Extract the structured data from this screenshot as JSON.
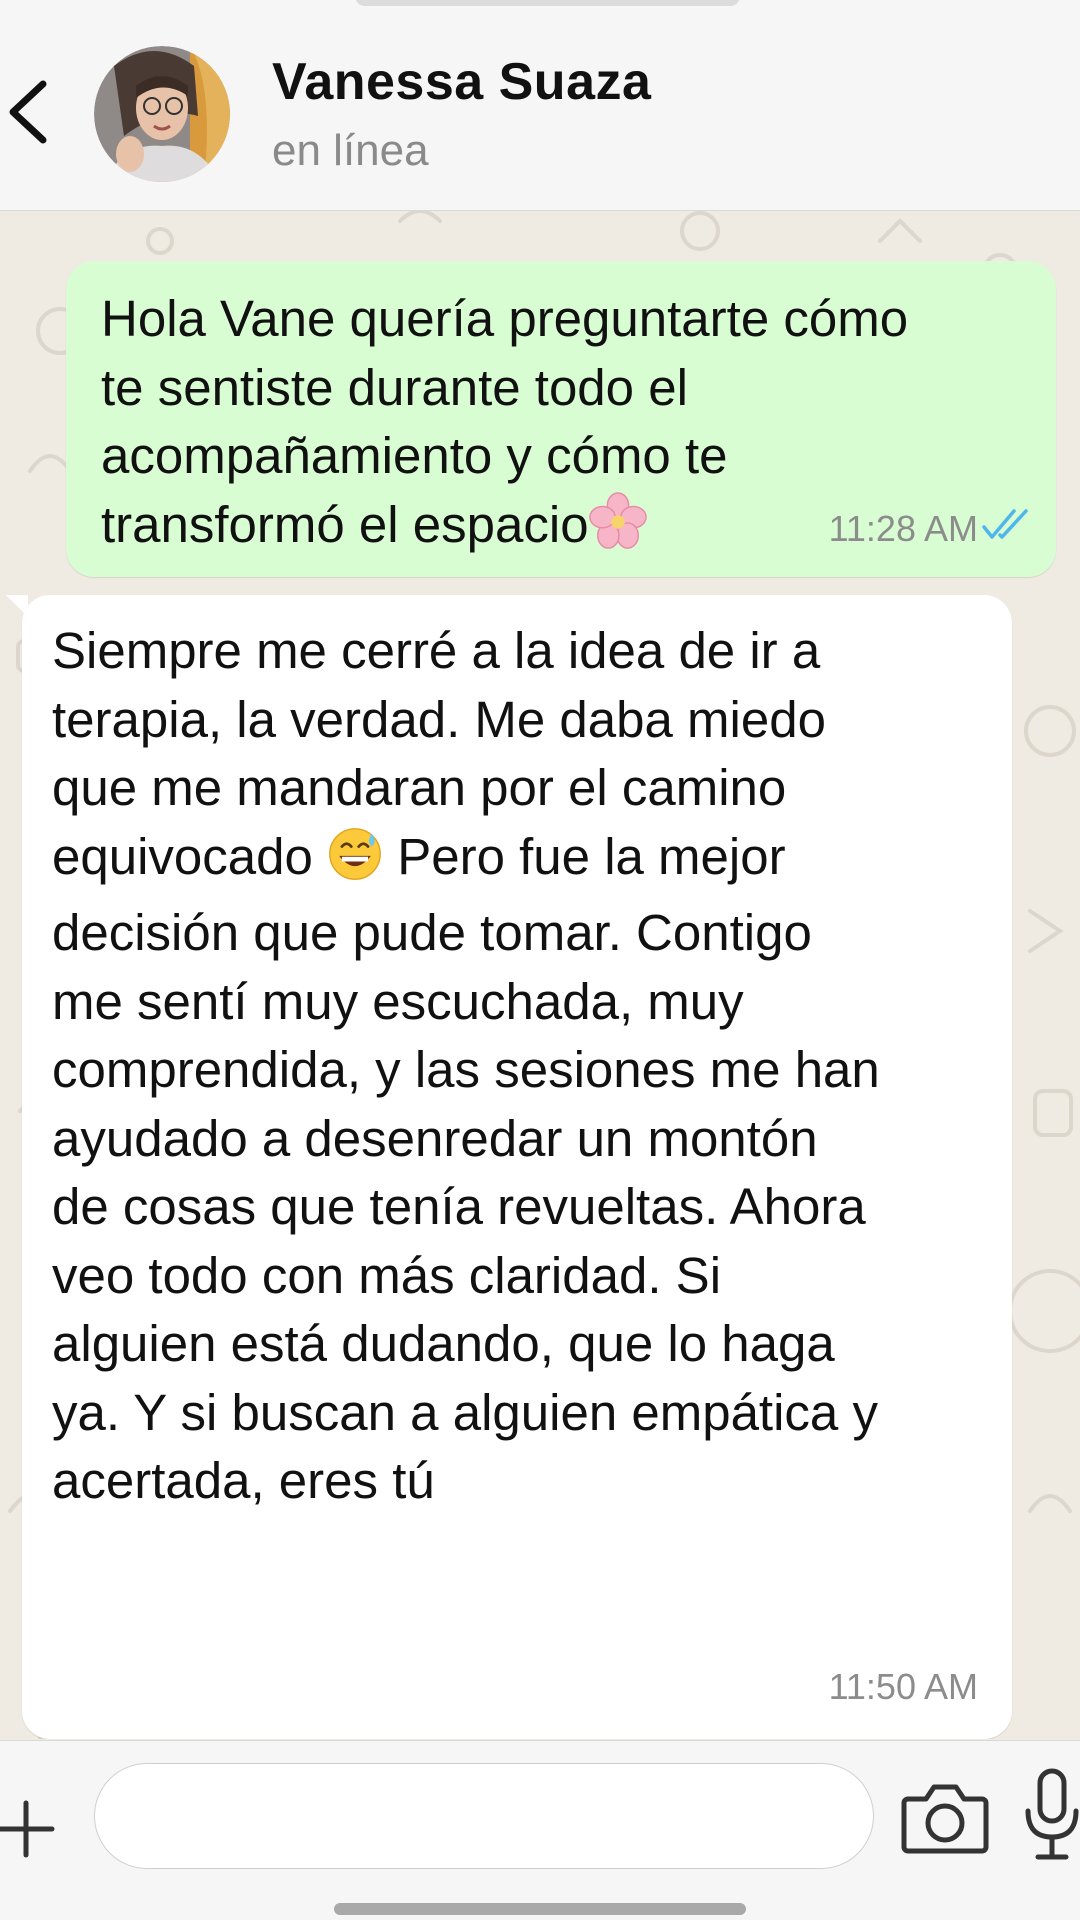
{
  "header": {
    "contact_name": "Vanessa Suaza",
    "status": "en línea",
    "back_icon": "chevron-left-icon",
    "avatar_icon": "contact-avatar-photo"
  },
  "messages": [
    {
      "direction": "outgoing",
      "lines": [
        "Hola Vane quería preguntarte cómo",
        "te sentiste durante todo el",
        "acompañamiento y cómo te",
        "transformó el espacio"
      ],
      "emoji": "🌸",
      "time": "11:28 AM",
      "read_status": "read-double-check"
    },
    {
      "direction": "incoming",
      "lines": [
        "Siempre me cerré a la idea de ir a",
        "terapia, la verdad. Me daba miedo",
        "que me mandaran por el camino",
        "equivocado",
        "decisión que pude tomar. Contigo",
        "me sentí muy escuchada, muy",
        "comprendida, y las sesiones me han",
        "ayudado a desenredar un montón",
        "de cosas que tenía revueltas. Ahora",
        "veo todo con más claridad. Si",
        "alguien está dudando, que lo haga",
        "ya. Y si buscan a alguien empática y",
        "acertada, eres tú"
      ],
      "inline_emoji": "😅",
      "line4_tail": "Pero fue la mejor",
      "time": "11:50 AM"
    }
  ],
  "input_bar": {
    "plus_icon": "plus-icon",
    "message_value": "",
    "camera_icon": "camera-icon",
    "mic_icon": "microphone-icon"
  },
  "colors": {
    "outgoing_bubble": "#d9fdd3",
    "incoming_bubble": "#ffffff",
    "chat_background": "#efeae2",
    "read_ticks": "#4fb6ec",
    "header_background": "#f6f6f6"
  }
}
